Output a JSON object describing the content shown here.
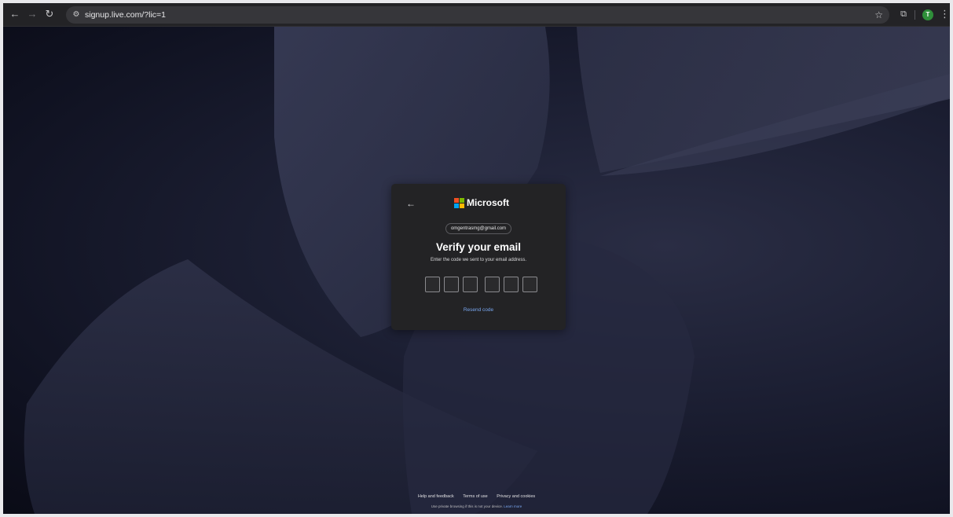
{
  "browser": {
    "url": "signup.live.com/?lic=1",
    "back_icon": "arrow-left-icon",
    "forward_icon": "arrow-right-icon",
    "reload_icon": "reload-icon",
    "site_info_icon": "tune-icon",
    "bookmark_icon": "star-icon",
    "extensions_icon": "puzzle-icon",
    "profile_initial": "T",
    "profile_color": "#2f8f3a",
    "menu_icon": "more-vert-icon"
  },
  "card": {
    "back_icon": "arrow-left-icon",
    "brand": "Microsoft",
    "brand_colors": [
      "#f25022",
      "#7fba00",
      "#00a4ef",
      "#ffb900"
    ],
    "email": "omgentrasmg@gmail.com",
    "title": "Verify your email",
    "subtitle": "Enter the code we sent to your email address.",
    "code_digits": [
      "",
      "",
      "",
      "",
      "",
      ""
    ],
    "resend_label": "Resend code",
    "link_color": "#79a7f0"
  },
  "footer": {
    "links": [
      "Help and feedback",
      "Terms of use",
      "Privacy and cookies"
    ],
    "note": "Use private browsing if this is not your device.",
    "learn_more": "Learn more"
  }
}
